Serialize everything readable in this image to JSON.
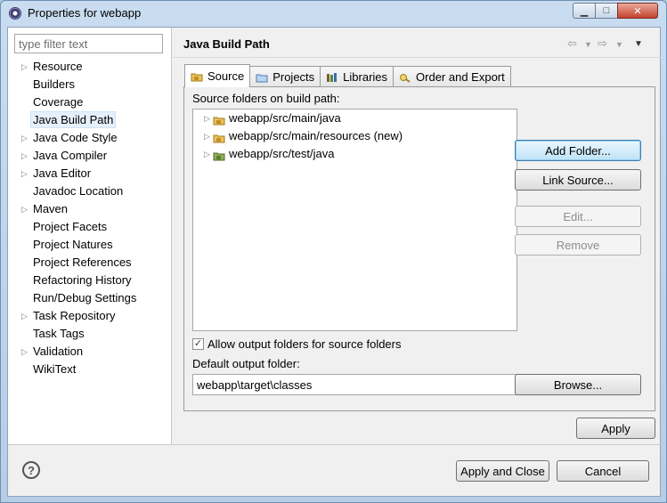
{
  "window": {
    "title": "Properties for webapp"
  },
  "filter": {
    "placeholder": "type filter text"
  },
  "sidebar": {
    "items": [
      {
        "label": "Resource",
        "expandable": true
      },
      {
        "label": "Builders",
        "expandable": false
      },
      {
        "label": "Coverage",
        "expandable": false
      },
      {
        "label": "Java Build Path",
        "expandable": false,
        "selected": true
      },
      {
        "label": "Java Code Style",
        "expandable": true
      },
      {
        "label": "Java Compiler",
        "expandable": true
      },
      {
        "label": "Java Editor",
        "expandable": true
      },
      {
        "label": "Javadoc Location",
        "expandable": false
      },
      {
        "label": "Maven",
        "expandable": true
      },
      {
        "label": "Project Facets",
        "expandable": false
      },
      {
        "label": "Project Natures",
        "expandable": false
      },
      {
        "label": "Project References",
        "expandable": false
      },
      {
        "label": "Refactoring History",
        "expandable": false
      },
      {
        "label": "Run/Debug Settings",
        "expandable": false
      },
      {
        "label": "Task Repository",
        "expandable": true
      },
      {
        "label": "Task Tags",
        "expandable": false
      },
      {
        "label": "Validation",
        "expandable": true
      },
      {
        "label": "WikiText",
        "expandable": false
      }
    ]
  },
  "page": {
    "title": "Java Build Path"
  },
  "tabs": [
    {
      "label": "Source",
      "icon": "source-folder-icon",
      "active": true
    },
    {
      "label": "Projects",
      "icon": "projects-icon",
      "active": false
    },
    {
      "label": "Libraries",
      "icon": "libraries-icon",
      "active": false
    },
    {
      "label": "Order and Export",
      "icon": "order-export-icon",
      "active": false
    }
  ],
  "source": {
    "label": "Source folders on build path:",
    "folders": [
      "webapp/src/main/java",
      "webapp/src/main/resources (new)",
      "webapp/src/test/java"
    ],
    "buttons": {
      "add_folder": "Add Folder...",
      "link_source": "Link Source...",
      "edit": "Edit...",
      "remove": "Remove"
    },
    "allow_output": {
      "label": "Allow output folders for source folders",
      "checked": true
    },
    "default_output_label": "Default output folder:",
    "default_output_value": "webapp\\target\\classes",
    "browse": "Browse..."
  },
  "footer": {
    "apply": "Apply",
    "apply_close": "Apply and Close",
    "cancel": "Cancel"
  },
  "colors": {
    "accent_button": "#bfe3f7",
    "selection": "#e5f0fb"
  }
}
